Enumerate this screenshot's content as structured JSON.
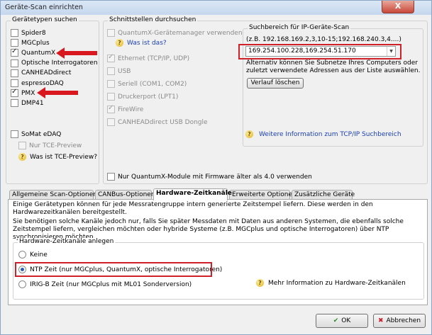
{
  "window": {
    "title": "Geräte-Scan einrichten",
    "close_label": "X"
  },
  "device_types": {
    "title": "Gerätetypen suchen",
    "items": [
      {
        "label": "Spider8",
        "checked": false
      },
      {
        "label": "MGCplus",
        "checked": false
      },
      {
        "label": "QuantumX",
        "checked": true
      },
      {
        "label": "Optische Interrogatoren",
        "checked": false
      },
      {
        "label": "CANHEADdirect",
        "checked": false
      },
      {
        "label": "espressoDAQ",
        "checked": false
      },
      {
        "label": "PMX",
        "checked": true
      },
      {
        "label": "DMP41",
        "checked": false
      }
    ],
    "somat_label": "SoMat eDAQ",
    "tce_preview_label": "Nur TCE-Preview",
    "tce_help_link": "Was ist TCE-Preview?"
  },
  "interfaces": {
    "title": "Schnittstellen durchsuchen",
    "quantumx_manager_label": "QuantumX-Gerätemanager verwenden",
    "what_is_that_link": "Was ist das?",
    "items": [
      {
        "label": "Ethernet (TCP/IP, UDP)",
        "checked": true
      },
      {
        "label": "USB",
        "checked": false
      },
      {
        "label": "Seriell (COM1, COM2)",
        "checked": false
      },
      {
        "label": "Druckerport (LPT1)",
        "checked": false
      },
      {
        "label": "FireWire",
        "checked": true
      },
      {
        "label": "CANHEADdirect USB Dongle",
        "checked": false
      }
    ],
    "old_firmware_label": "Nur QuantumX-Module mit Firmware älter als 4.0 verwenden"
  },
  "ip_scan": {
    "title": "Suchbereich für IP-Geräte-Scan",
    "example": "(z.B. 192.168.169.2,3,10-15;192.168.240.3,4....)",
    "value": "169.254.100.228,169.254.51.170",
    "hint": "Alternativ können Sie Subnetze Ihres Computers oder zuletzt verwendete Adressen aus der Liste auswählen.",
    "clear_history_button": "Verlauf löschen",
    "more_info_link": "Weitere Information zum TCP/IP Suchbereich"
  },
  "tabs": [
    {
      "label": "Allgemeine Scan-Optionen",
      "active": false
    },
    {
      "label": "CANBus-Optionen",
      "active": false
    },
    {
      "label": "Hardware-Zeitkanäle",
      "active": true
    },
    {
      "label": "Erweiterte Optionen",
      "active": false
    },
    {
      "label": "Zusätzliche Geräte",
      "active": false
    }
  ],
  "hardware_time": {
    "description1": "Einige Gerätetypen können für jede Messratengruppe intern generierte Zeitstempel liefern. Diese werden in den Hardwarezeitkanälen bereitgestellt.",
    "description2": "Sie benötigen solche Kanäle jedoch nur, falls Sie später Messdaten mit Daten aus anderen Systemen, die ebenfalls solche Zeitstempel liefern, vergleichen möchten oder hybride Systeme (z.B. MGCplus und optische Interrogatoren) über NTP synchronisieren möchten.",
    "group_title": "Hardware-Zeitkanäle anlegen",
    "options": [
      {
        "label": "Keine",
        "checked": false
      },
      {
        "label": "NTP Zeit (nur MGCplus, QuantumX, optische Interrogatoren)",
        "checked": true
      },
      {
        "label": "IRIG-B Zeit (nur MGCplus mit ML01 Sonderversion)",
        "checked": false
      }
    ],
    "more_info_link": "Mehr Information zu  Hardware-Zeitkanälen"
  },
  "buttons": {
    "ok": "OK",
    "cancel": "Abbrechen"
  },
  "colors": {
    "highlight": "#d0202a",
    "link": "#1a3fb0"
  }
}
